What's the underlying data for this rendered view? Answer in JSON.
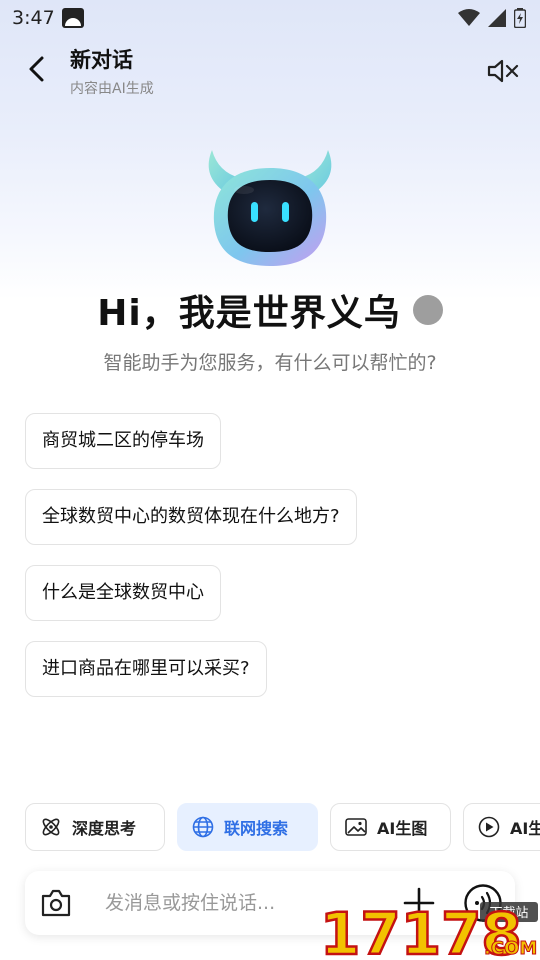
{
  "status_bar": {
    "time": "3:47"
  },
  "header": {
    "title": "新对话",
    "subtitle": "内容由AI生成"
  },
  "greeting": {
    "title": "Hi，我是世界义乌",
    "subtitle": "智能助手为您服务，有什么可以帮忙的?"
  },
  "suggestions": [
    "商贸城二区的停车场",
    "全球数贸中心的数贸体现在什么地方?",
    "什么是全球数贸中心",
    "进口商品在哪里可以采买?"
  ],
  "chips": [
    {
      "label": "深度思考",
      "icon": "atom-icon"
    },
    {
      "label": "联网搜索",
      "icon": "globe-icon",
      "active": true
    },
    {
      "label": "AI生图",
      "icon": "image-icon"
    },
    {
      "label": "AI生",
      "icon": "ai-video-icon"
    }
  ],
  "input": {
    "placeholder": "发消息或按住说话..."
  },
  "watermark": {
    "text": "17178",
    "sub": ".COM",
    "tag": "下载站"
  },
  "colors": {
    "accent": "#2f6fe5",
    "chip_active_bg": "#e7f0ff",
    "greeting_dot": "#9e9e9e"
  }
}
